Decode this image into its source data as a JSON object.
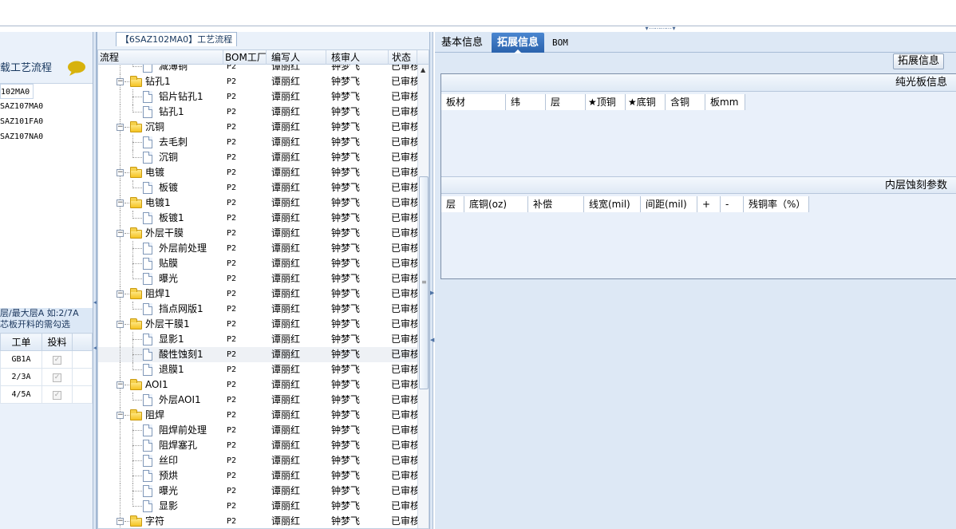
{
  "left": {
    "title": "载工艺流程",
    "orders": [
      "102MA0",
      "SAZ107MA0",
      "SAZ101FA0",
      "SAZ107NA0"
    ],
    "note_line1": "层/最大层A 如:2/7A",
    "note_line2": "芯板开料的需勾选",
    "table_headers": [
      "工单",
      "投料"
    ],
    "table_rows": [
      {
        "order": "GB1A",
        "checked": true
      },
      {
        "order": "2/3A",
        "checked": true
      },
      {
        "order": "4/5A",
        "checked": true
      }
    ]
  },
  "flow": {
    "title": "【6SAZ102MA0】工艺流程",
    "headers": {
      "name": "流程",
      "bom": "BOM工厂",
      "writer": "编写人",
      "reviewer": "核审人",
      "status": "状态"
    },
    "rows": [
      {
        "name": "减薄铜",
        "level": 2,
        "bom": "P2",
        "writer": "谭丽红",
        "reviewer": "钟梦飞",
        "status": "已审核"
      },
      {
        "name": "钻孔1",
        "level": 1,
        "bom": "P2",
        "writer": "谭丽红",
        "reviewer": "钟梦飞",
        "status": "已审核"
      },
      {
        "name": "铝片钻孔1",
        "level": 2,
        "bom": "P2",
        "writer": "谭丽红",
        "reviewer": "钟梦飞",
        "status": "已审核"
      },
      {
        "name": "钻孔1",
        "level": 2,
        "bom": "P2",
        "writer": "谭丽红",
        "reviewer": "钟梦飞",
        "status": "已审核"
      },
      {
        "name": "沉铜",
        "level": 1,
        "bom": "P2",
        "writer": "谭丽红",
        "reviewer": "钟梦飞",
        "status": "已审核"
      },
      {
        "name": "去毛刺",
        "level": 2,
        "bom": "P2",
        "writer": "谭丽红",
        "reviewer": "钟梦飞",
        "status": "已审核"
      },
      {
        "name": "沉铜",
        "level": 2,
        "bom": "P2",
        "writer": "谭丽红",
        "reviewer": "钟梦飞",
        "status": "已审核"
      },
      {
        "name": "电镀",
        "level": 1,
        "bom": "P2",
        "writer": "谭丽红",
        "reviewer": "钟梦飞",
        "status": "已审核"
      },
      {
        "name": "板镀",
        "level": 2,
        "bom": "P2",
        "writer": "谭丽红",
        "reviewer": "钟梦飞",
        "status": "已审核"
      },
      {
        "name": "电镀1",
        "level": 1,
        "bom": "P2",
        "writer": "谭丽红",
        "reviewer": "钟梦飞",
        "status": "已审核"
      },
      {
        "name": "板镀1",
        "level": 2,
        "bom": "P2",
        "writer": "谭丽红",
        "reviewer": "钟梦飞",
        "status": "已审核"
      },
      {
        "name": "外层干膜",
        "level": 1,
        "bom": "P2",
        "writer": "谭丽红",
        "reviewer": "钟梦飞",
        "status": "已审核"
      },
      {
        "name": "外层前处理",
        "level": 2,
        "bom": "P2",
        "writer": "谭丽红",
        "reviewer": "钟梦飞",
        "status": "已审核"
      },
      {
        "name": "贴膜",
        "level": 2,
        "bom": "P2",
        "writer": "谭丽红",
        "reviewer": "钟梦飞",
        "status": "已审核"
      },
      {
        "name": "曝光",
        "level": 2,
        "bom": "P2",
        "writer": "谭丽红",
        "reviewer": "钟梦飞",
        "status": "已审核"
      },
      {
        "name": "阻焊1",
        "level": 1,
        "bom": "P2",
        "writer": "谭丽红",
        "reviewer": "钟梦飞",
        "status": "已审核"
      },
      {
        "name": "挡点网版1",
        "level": 2,
        "bom": "P2",
        "writer": "谭丽红",
        "reviewer": "钟梦飞",
        "status": "已审核"
      },
      {
        "name": "外层干膜1",
        "level": 1,
        "bom": "P2",
        "writer": "谭丽红",
        "reviewer": "钟梦飞",
        "status": "已审核"
      },
      {
        "name": "显影1",
        "level": 2,
        "bom": "P2",
        "writer": "谭丽红",
        "reviewer": "钟梦飞",
        "status": "已审核"
      },
      {
        "name": "酸性蚀刻1",
        "level": 2,
        "bom": "P2",
        "writer": "谭丽红",
        "reviewer": "钟梦飞",
        "status": "已审核",
        "selected": true
      },
      {
        "name": "退膜1",
        "level": 2,
        "bom": "P2",
        "writer": "谭丽红",
        "reviewer": "钟梦飞",
        "status": "已审核"
      },
      {
        "name": "AOI1",
        "level": 1,
        "bom": "P2",
        "writer": "谭丽红",
        "reviewer": "钟梦飞",
        "status": "已审核"
      },
      {
        "name": "外层AOI1",
        "level": 2,
        "bom": "P2",
        "writer": "谭丽红",
        "reviewer": "钟梦飞",
        "status": "已审核"
      },
      {
        "name": "阻焊",
        "level": 1,
        "bom": "P2",
        "writer": "谭丽红",
        "reviewer": "钟梦飞",
        "status": "已审核"
      },
      {
        "name": "阻焊前处理",
        "level": 2,
        "bom": "P2",
        "writer": "谭丽红",
        "reviewer": "钟梦飞",
        "status": "已审核"
      },
      {
        "name": "阻焊塞孔",
        "level": 2,
        "bom": "P2",
        "writer": "谭丽红",
        "reviewer": "钟梦飞",
        "status": "已审核"
      },
      {
        "name": "丝印",
        "level": 2,
        "bom": "P2",
        "writer": "谭丽红",
        "reviewer": "钟梦飞",
        "status": "已审核"
      },
      {
        "name": "预烘",
        "level": 2,
        "bom": "P2",
        "writer": "谭丽红",
        "reviewer": "钟梦飞",
        "status": "已审核"
      },
      {
        "name": "曝光",
        "level": 2,
        "bom": "P2",
        "writer": "谭丽红",
        "reviewer": "钟梦飞",
        "status": "已审核"
      },
      {
        "name": "显影",
        "level": 2,
        "bom": "P2",
        "writer": "谭丽红",
        "reviewer": "钟梦飞",
        "status": "已审核"
      },
      {
        "name": "字符",
        "level": 1,
        "bom": "P2",
        "writer": "谭丽红",
        "reviewer": "钟梦飞",
        "status": "已审核"
      }
    ]
  },
  "right": {
    "tabs": [
      "基本信息",
      "拓展信息",
      "BOM"
    ],
    "active_tab": "拓展信息",
    "ext_button": "拓展信息",
    "section1": {
      "title": "纯光板信息",
      "columns": [
        "板材",
        "纬",
        "层",
        "★顶铜",
        "★底铜",
        "含铜",
        "板mm"
      ]
    },
    "section2": {
      "title": "内层蚀刻参数",
      "columns": [
        "层",
        "底铜(oz)",
        "补偿",
        "线宽(mil)",
        "间距(mil)",
        "+",
        "-",
        "残铜率（%）"
      ]
    }
  },
  "colors": {
    "accent": "#2b63ad",
    "panel_bg": "#eaf1fa",
    "folder": "#f5c423"
  }
}
